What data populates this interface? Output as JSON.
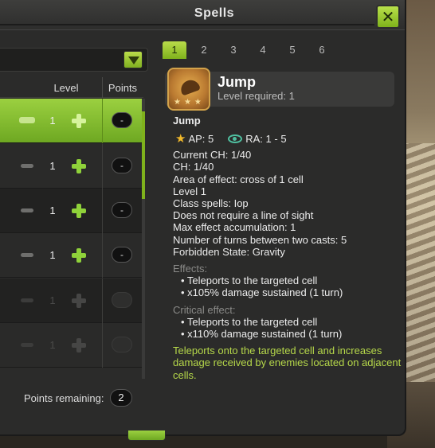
{
  "window": {
    "title": "Spells",
    "close_label": "✕"
  },
  "spell_list": {
    "headers": {
      "level": "Level",
      "points": "Points"
    },
    "rows": [
      {
        "level": "1",
        "points": "-",
        "state": "selected"
      },
      {
        "level": "1",
        "points": "-",
        "state": "normal"
      },
      {
        "level": "1",
        "points": "-",
        "state": "normal"
      },
      {
        "level": "1",
        "points": "-",
        "state": "normal"
      },
      {
        "level": "1",
        "points": "",
        "state": "disabled"
      },
      {
        "level": "1",
        "points": "",
        "state": "disabled"
      }
    ],
    "points_remaining_label": "Points remaining:",
    "points_remaining_value": "2"
  },
  "level_tabs": [
    "1",
    "2",
    "3",
    "4",
    "5",
    "6"
  ],
  "active_tab": "1",
  "spell": {
    "name": "Jump",
    "level_required": "Level required: 1",
    "subtitle": "Jump",
    "ap": "AP: 5",
    "ra": "RA: 1 - 5",
    "lines": [
      "Current CH: 1/40",
      "CH: 1/40",
      "Area of effect: cross of 1 cell",
      "Level 1",
      "Class spells: Iop",
      "Does not require a line of sight",
      "Max effect accumulation: 1",
      "Number of turns between two casts: 5",
      "Forbidden State: Gravity"
    ],
    "effects_label": "Effects:",
    "effects": [
      "• Teleports to the targeted cell",
      "• x105% damage sustained (1 turn)"
    ],
    "critical_label": "Critical effect:",
    "critical_effects": [
      "• Teleports to the targeted cell",
      "• x110% damage sustained (1 turn)"
    ],
    "description": "Teleports onto the targeted cell and increases damage received by enemies located on adjacent cells."
  },
  "colors": {
    "accent_green": "#8fd23a",
    "description_text": "#b6d84a",
    "ap_star": "#f2b92b",
    "ra_eye": "#4fc0a0"
  }
}
